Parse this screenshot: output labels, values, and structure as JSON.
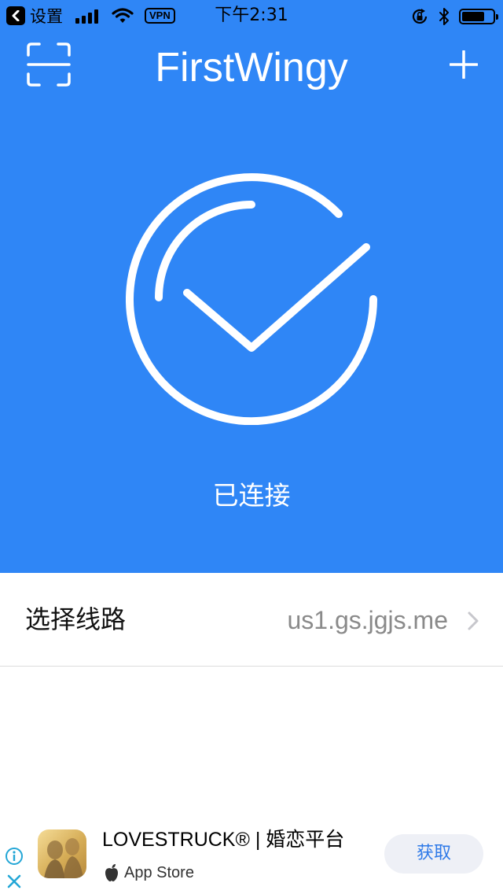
{
  "status_bar": {
    "back_label": "设置",
    "vpn": "VPN",
    "time": "下午2:31"
  },
  "nav": {
    "title": "FirstWingy",
    "left_icon": "scan-icon",
    "right_icon": "plus-icon"
  },
  "connection": {
    "status_text": "已连接",
    "icon": "check-circle-icon"
  },
  "route": {
    "label": "选择线路",
    "value": "us1.gs.jgjs.me"
  },
  "ad": {
    "title": "LOVESTRUCK® | 婚恋平台",
    "store": "App Store",
    "button": "获取"
  },
  "colors": {
    "primary": "#2f86f6",
    "text_secondary": "#8a8a8a",
    "ad_button_bg": "#eef0f6",
    "ad_button_text": "#2f7ae8"
  }
}
